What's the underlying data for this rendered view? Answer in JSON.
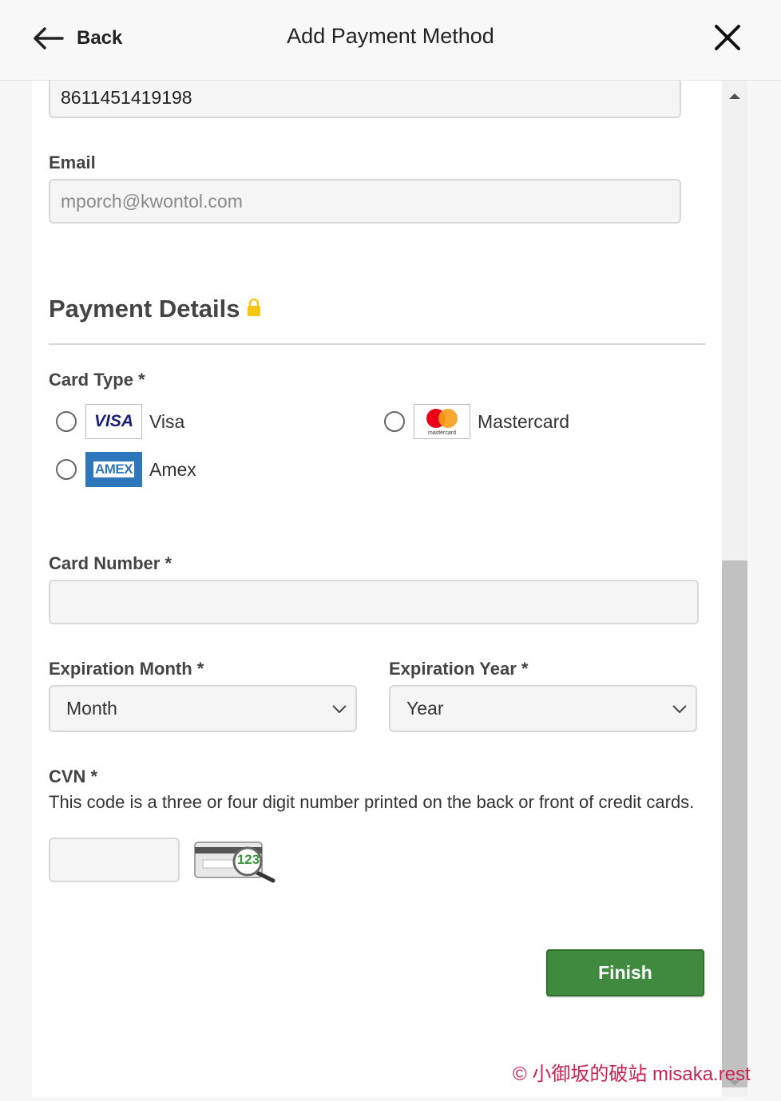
{
  "header": {
    "back_label": "Back",
    "title": "Add Payment Method"
  },
  "form": {
    "phone_value": "8611451419198",
    "email_label": "Email",
    "email_value": "mporch@kwontol.com",
    "payment_details_title": "Payment Details",
    "card_type_label": "Card Type *",
    "card_types": [
      {
        "label": "Visa",
        "logo_text": "VISA"
      },
      {
        "label": "Mastercard",
        "logo_text": "mastercard"
      },
      {
        "label": "Amex",
        "logo_text": "AMEX"
      }
    ],
    "card_number_label": "Card Number *",
    "card_number_value": "",
    "exp_month_label": "Expiration Month *",
    "exp_month_selected": "Month",
    "exp_year_label": "Expiration Year *",
    "exp_year_selected": "Year",
    "cvn_label": "CVN *",
    "cvn_description": "This code is a three or four digit number printed on the back or front of credit cards.",
    "cvn_value": "",
    "cvn_image_text": "123",
    "finish_label": "Finish"
  },
  "watermark": "© 小御坂的破站 misaka.rest",
  "colors": {
    "finish_bg": "#3f8a3f",
    "lock": "#f5c518",
    "watermark": "#c8234e"
  }
}
